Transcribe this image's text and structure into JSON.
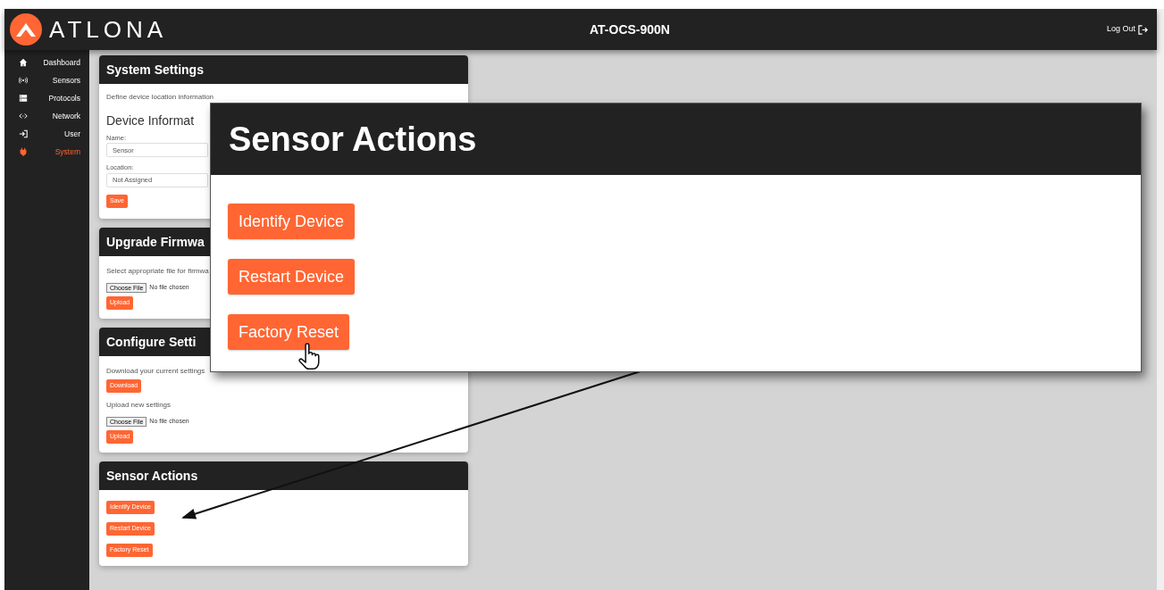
{
  "header": {
    "logo": "ATLONA",
    "title": "AT-OCS-900N",
    "logout": "Log Out"
  },
  "sidebar": {
    "items": [
      {
        "label": "Dashboard",
        "selected": false
      },
      {
        "label": "Sensors",
        "selected": false
      },
      {
        "label": "Protocols",
        "selected": false
      },
      {
        "label": "Network",
        "selected": false
      },
      {
        "label": "User",
        "selected": false
      },
      {
        "label": "System",
        "selected": true
      }
    ]
  },
  "system_settings": {
    "title": "System Settings",
    "description": "Define device location information",
    "subheading": "Device Informat",
    "name_label": "Name:",
    "name_value": "Sensor",
    "location_label": "Location:",
    "location_value": "Not Assigned",
    "save_button": "Save"
  },
  "upgrade_firmware": {
    "title": "Upgrade Firmwa",
    "description": "Select appropriate file for firmwa",
    "file_button": "Choose File",
    "file_status": "No file chosen",
    "upload_button": "Upload"
  },
  "configure_settings": {
    "title": "Configure Setti",
    "download_description": "Download your current settings",
    "download_button": "Download",
    "upload_description": "Upload new settings",
    "file_button": "Choose File",
    "file_status": "No file chosen",
    "upload_button": "Upload"
  },
  "sensor_actions": {
    "title": "Sensor Actions",
    "buttons": [
      "Identify Device",
      "Restart Device",
      "Factory Reset"
    ]
  },
  "callout": {
    "title": "Sensor Actions",
    "buttons": [
      "Identify Device",
      "Restart Device",
      "Factory Reset"
    ]
  }
}
